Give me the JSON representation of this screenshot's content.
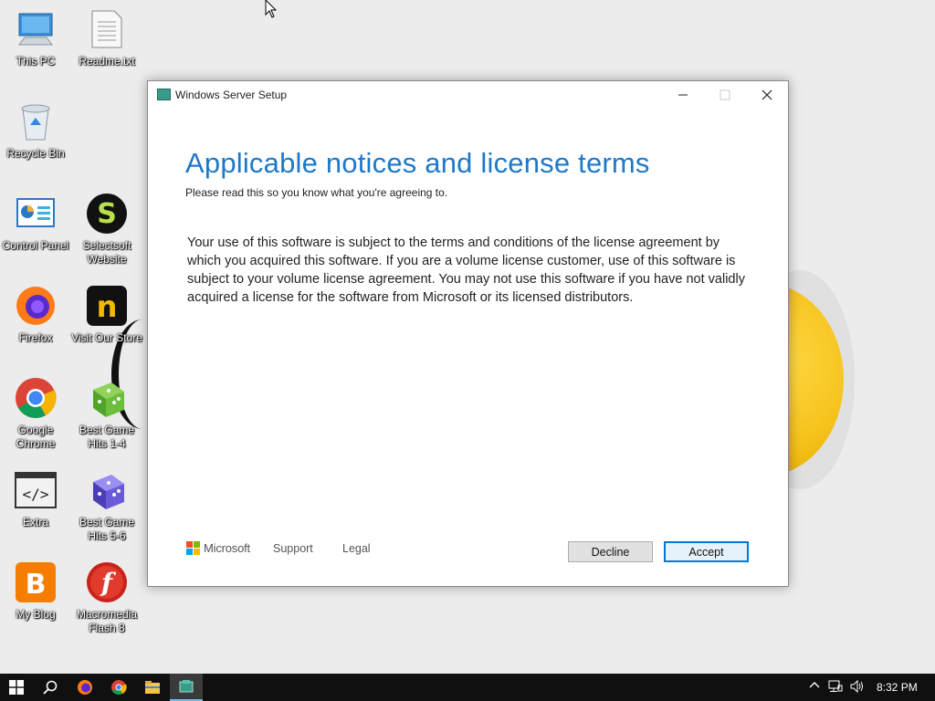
{
  "desktop": {
    "icons": [
      {
        "label": "This PC"
      },
      {
        "label": "Readme.txt"
      },
      {
        "label": "Recycle Bin"
      },
      {
        "label": "Control Panel"
      },
      {
        "label": "Selectsoft Website"
      },
      {
        "label": "Firefox"
      },
      {
        "label": "Visit Our Store"
      },
      {
        "label": "Google Chrome"
      },
      {
        "label": "Best Game Hits 1-4"
      },
      {
        "label": "Extra"
      },
      {
        "label": "Best Game Hits 5-6"
      },
      {
        "label": "My Blog"
      },
      {
        "label": "Macromedia Flash 8"
      }
    ]
  },
  "dialog": {
    "title": "Windows Server Setup",
    "heading": "Applicable notices and license terms",
    "subheading": "Please read this so you know what you're agreeing to.",
    "body": "Your use of this software is subject to the terms and conditions of the license agreement by which you acquired this software.  If you are a volume license customer, use of this software is subject to your volume license agreement.  You may not use this software if you have not validly acquired a license for the software from Microsoft or its licensed distributors.",
    "footer": {
      "brand": "Microsoft",
      "support_label": "Support",
      "legal_label": "Legal",
      "decline_label": "Decline",
      "accept_label": "Accept"
    },
    "accent_color": "#1e79c8"
  },
  "taskbar": {
    "clock": "8:32 PM",
    "pinned": [
      "windows-start-icon",
      "search-icon",
      "firefox-icon",
      "chrome-icon",
      "file-explorer-icon",
      "windows-setup-icon"
    ]
  }
}
